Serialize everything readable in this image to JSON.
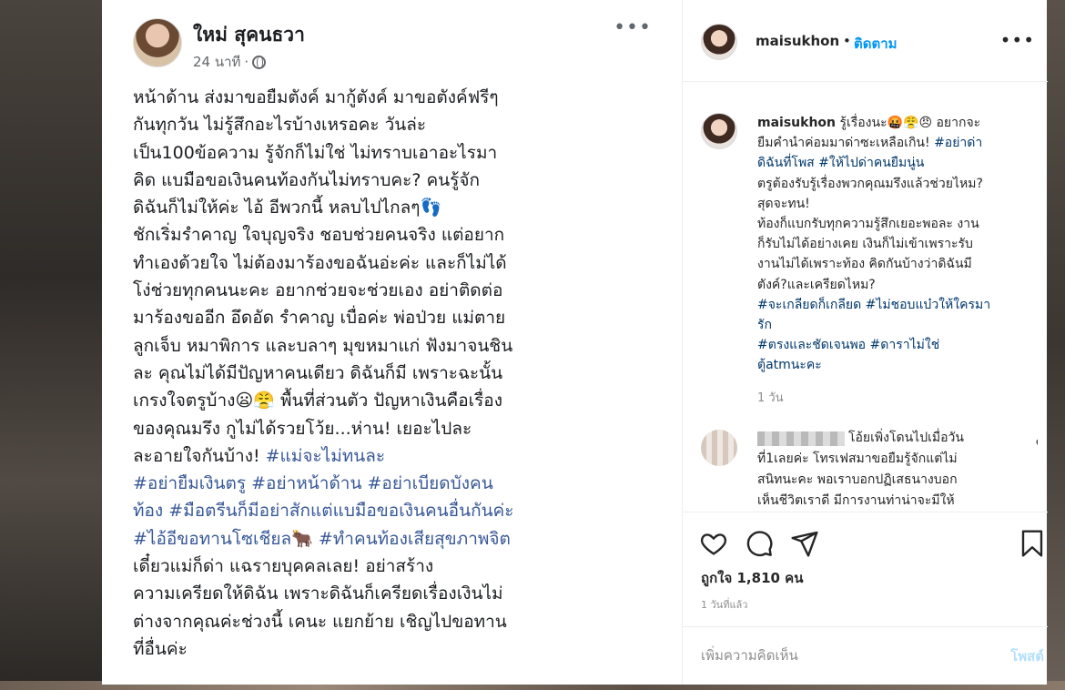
{
  "facebook_post": {
    "author_name": "ใหม่ สุคนธวา",
    "timestamp": "24 นาที",
    "separator": "·",
    "more_icon": "more-horizontal-icon",
    "privacy_icon": "globe-icon",
    "lines": [
      {
        "text": "หน้าด้าน ส่งมาขอยืมตังค์ มากู้ตังค์ มาขอตังค์ฟรีๆ",
        "tag": false
      },
      {
        "text": "กันทุกวัน ไม่รู้สึกอะไรบ้างเหรอคะ วันล่ะ",
        "tag": false
      },
      {
        "text": "เป็น100ข้อความ รู้จักก็ไม่ใช่ ไม่ทราบเอาอะไรมา",
        "tag": false
      },
      {
        "text": "คิด แบมือขอเงินคนท้องกันไม่ทราบคะ? คนรู้จัก",
        "tag": false
      },
      {
        "text": "ดิฉันก็ไม่ให้ค่ะ ไอ้ อีพวกนี้ หลบไปไกลๆ👣",
        "tag": false
      },
      {
        "text": "ชักเริ่มรำคาญ ใจบุญจริง ชอบช่วยคนจริง แต่อยาก",
        "tag": false
      },
      {
        "text": "ทำเองด้วยใจ ไม่ต้องมาร้องขอฉันอ่ะค่ะ และก็ไม่ได้",
        "tag": false
      },
      {
        "text": "โง่ช่วยทุกคนนะคะ อยากช่วยจะช่วยเอง อย่าติดต่อ",
        "tag": false
      },
      {
        "text": "มาร้องขออีก อึดอัด รำคาญ เบื่อค่ะ พ่อป่วย แม่ตาย",
        "tag": false
      },
      {
        "text": "ลูกเจ็บ หมาพิการ และบลาๆ มุขหมาแก่ ฟังมาจนชิน",
        "tag": false
      },
      {
        "text": "ละ คุณไม่ได้มีปัญหาคนเดียว ดิฉันก็มี เพราะฉะนั้น",
        "tag": false
      },
      {
        "text": "เกรงใจตรูบ้าง😦😤 พื้นที่ส่วนตัว ปัญหาเงินคือเรื่อง",
        "tag": false
      },
      {
        "text": "ของคุณมรึง กูไม่ได้รวยโว้ย...ห่าน! เยอะไปละ",
        "tag": false
      },
      {
        "text": "ละอายใจกันบ้าง! ",
        "tag": false,
        "tail": "#แม่จะไม่ทนละ"
      },
      {
        "text": "#อย่ายืมเงินตรู #อย่าหน้าด้าน #อย่าเบียดบังคน",
        "tag": true
      },
      {
        "text": "ท้อง #มือตรีนก็มีอย่าสักแต่แบมือขอเงินคนอื่นกันค่ะ",
        "tag": true
      },
      {
        "text": "#ไอ้อีขอทานโซเชียล🐂 #ทำคนท้องเสียสุขภาพจิต",
        "tag": true
      },
      {
        "text": "เดี๋ยวแม่ก็ด่า แฉรายบุคคลเลย! อย่าสร้าง",
        "tag": false
      },
      {
        "text": "ความเครียดให้ดิฉัน เพราะดิฉันก็เครียดเรื่องเงินไม่",
        "tag": false
      },
      {
        "text": "ต่างจากคุณค่ะช่วงนี้ เคนะ แยกย้าย เชิญไปขอทาน",
        "tag": false
      },
      {
        "text": "ที่อื่นค่ะ",
        "tag": false
      }
    ]
  },
  "instagram": {
    "username": "maisukhon",
    "dot": "•",
    "follow_label": "ติดตาม",
    "more_icon": "more-horizontal-icon",
    "caption_lines": [
      {
        "parts": [
          {
            "t": "maisukhon",
            "s": "strong"
          },
          {
            "t": " รู้เรื่องนะ🤬😤😠 อยากจะ",
            "s": ""
          }
        ]
      },
      {
        "parts": [
          {
            "t": "ยืมคำนำค่อมมาด่าซะเหลือเกิน! ",
            "s": ""
          },
          {
            "t": "#อย่าด่า",
            "s": "tag"
          }
        ]
      },
      {
        "parts": [
          {
            "t": "ดิฉันที่โพส #ให้ไปด่าคนยืมนู่น",
            "s": "tag"
          }
        ]
      },
      {
        "parts": [
          {
            "t": "ตรูต้องรับรู้เรื่องพวกคุณมรึงแล้วช่วยไหม?",
            "s": ""
          }
        ]
      },
      {
        "parts": [
          {
            "t": "สุดจะทน!",
            "s": ""
          }
        ]
      },
      {
        "parts": [
          {
            "t": "ท้องก็แบกรับทุกความรู้สึกเยอะพอละ งาน",
            "s": ""
          }
        ]
      },
      {
        "parts": [
          {
            "t": "ก็รับไม่ได้อย่างเคย เงินก็ไม่เข้าเพราะรับ",
            "s": ""
          }
        ]
      },
      {
        "parts": [
          {
            "t": "งานไม่ได้เพราะท้อง คิดกันบ้างว่าดิฉันมี",
            "s": ""
          }
        ]
      },
      {
        "parts": [
          {
            "t": "ตังค์?และเครียดไหม?",
            "s": ""
          }
        ]
      },
      {
        "parts": [
          {
            "t": "#จะเกลียดก็เกลียด #ไม่ชอบแบ๋วให้ใครมา",
            "s": "tag"
          }
        ]
      },
      {
        "parts": [
          {
            "t": "รัก",
            "s": "tag"
          }
        ]
      },
      {
        "parts": [
          {
            "t": "#ตรงและชัดเจนพอ #ดาราไม่ใช่",
            "s": "tag"
          }
        ]
      },
      {
        "parts": [
          {
            "t": "ตู้atmนะคะ",
            "s": "tag"
          }
        ]
      }
    ],
    "caption_age": "1 วัน",
    "comment": {
      "lines": [
        "โอ้ยเพิ่งโดนไปเมื่อวัน",
        "ที่1เลยค่ะ โทรเฟสมาขอยืมรู้จักแต่ไม่",
        "สนิทนะคะ พอเราบอกปฏิเสธนางบอก",
        "เห็นชีวิตเราดี มีการงานท่าน่าจะมีให้"
      ],
      "heart_icon": "heart-outline-icon"
    },
    "action_icons": [
      "heart-icon",
      "comment-icon",
      "share-icon",
      "bookmark-icon"
    ],
    "likes_label": "ถูกใจ 1,810 คน",
    "post_age": "1 วันที่แล้ว",
    "comment_placeholder": "เพิ่มความคิดเห็น",
    "post_button": "โพสต์",
    "colors": {
      "follow": "#0095f6",
      "hashtag_ig": "#00376b",
      "hashtag_fb": "#385898",
      "post_button_disabled": "#b2dffc"
    }
  }
}
